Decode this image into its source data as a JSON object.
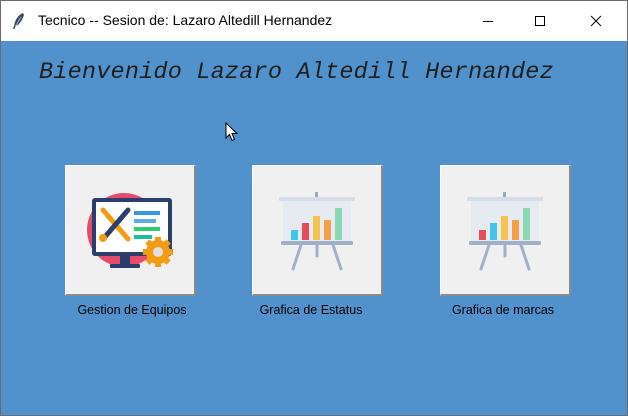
{
  "window": {
    "title": "Tecnico -- Sesion de: Lazaro Altedill Hernandez",
    "controls": {
      "minimize_icon": "minimize-icon",
      "maximize_icon": "maximize-icon",
      "close_icon": "close-icon"
    }
  },
  "main": {
    "welcome": "Bienvenido Lazaro Altedill Hernandez",
    "background_color": "#5292cc",
    "tiles": [
      {
        "label": "Gestion de Equipos",
        "icon": "computer-tools-icon"
      },
      {
        "label": "Grafica de Estatus",
        "icon": "presentation-chart-icon"
      },
      {
        "label": "Grafica de marcas",
        "icon": "presentation-chart-icon"
      }
    ]
  }
}
